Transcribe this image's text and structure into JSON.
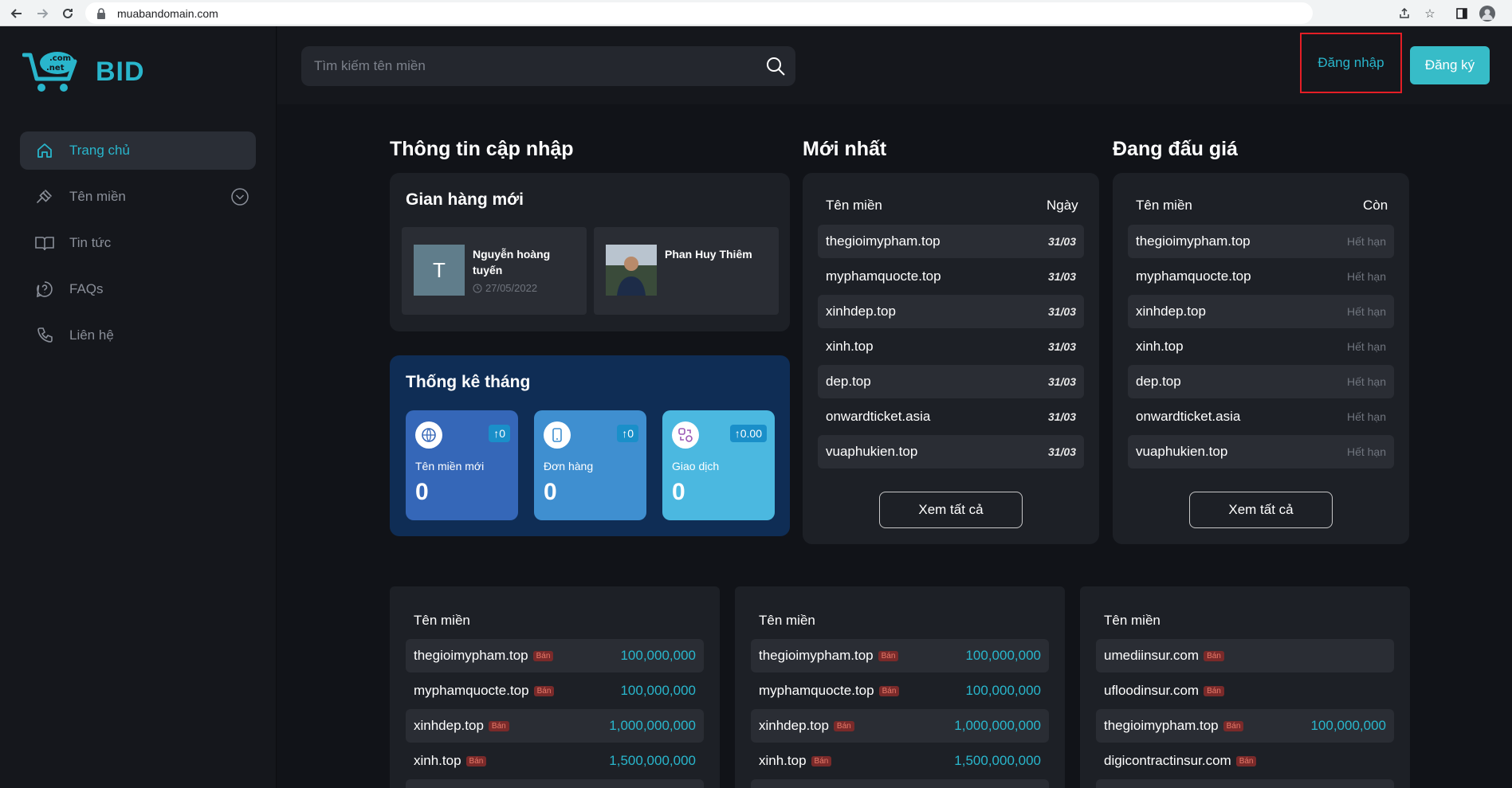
{
  "browser": {
    "url": "muabandomain.com"
  },
  "brand": {
    "logo_text": "BID",
    "logo_tag_top": ".com",
    "logo_tag_bottom": ".net"
  },
  "sidebar": {
    "items": [
      {
        "label": "Trang chủ",
        "icon": "home-icon",
        "active": true
      },
      {
        "label": "Tên miền",
        "icon": "gavel-icon",
        "has_chevron": true
      },
      {
        "label": "Tin tức",
        "icon": "book-icon"
      },
      {
        "label": "FAQs",
        "icon": "question-icon"
      },
      {
        "label": "Liên hệ",
        "icon": "phone-icon"
      }
    ]
  },
  "header": {
    "search_placeholder": "Tìm kiếm tên miền",
    "login_label": "Đăng nhập",
    "register_label": "Đăng ký"
  },
  "updates": {
    "title": "Thông tin cập nhập",
    "new_shops_title": "Gian hàng mới",
    "shops": [
      {
        "avatar_letter": "T",
        "name": "Nguyễn hoàng tuyến",
        "date": "27/05/2022"
      },
      {
        "name": "Phan Huy Thiêm"
      }
    ],
    "stats_title": "Thống kê tháng",
    "stats": [
      {
        "label": "Tên miền mới",
        "value": "0",
        "badge": "↑0",
        "color": "#3567b8"
      },
      {
        "label": "Đơn hàng",
        "value": "0",
        "badge": "↑0",
        "color": "#3f8fd0"
      },
      {
        "label": "Giao dịch",
        "value": "0",
        "badge": "↑0.00",
        "color": "#4bb8e0"
      }
    ]
  },
  "newest": {
    "title": "Mới nhất",
    "col_name": "Tên miền",
    "col_right": "Ngày",
    "rows": [
      {
        "name": "thegioimypham.top",
        "value": "31/03"
      },
      {
        "name": "myphamquocte.top",
        "value": "31/03"
      },
      {
        "name": "xinhdep.top",
        "value": "31/03"
      },
      {
        "name": "xinh.top",
        "value": "31/03"
      },
      {
        "name": "dep.top",
        "value": "31/03"
      },
      {
        "name": "onwardticket.asia",
        "value": "31/03"
      },
      {
        "name": "vuaphukien.top",
        "value": "31/03"
      }
    ],
    "view_all": "Xem tất cả"
  },
  "auction": {
    "title": "Đang đấu giá",
    "col_name": "Tên miền",
    "col_right": "Còn",
    "rows": [
      {
        "name": "thegioimypham.top",
        "value": "Hết hạn"
      },
      {
        "name": "myphamquocte.top",
        "value": "Hết hạn"
      },
      {
        "name": "xinhdep.top",
        "value": "Hết hạn"
      },
      {
        "name": "xinh.top",
        "value": "Hết hạn"
      },
      {
        "name": "dep.top",
        "value": "Hết hạn"
      },
      {
        "name": "onwardticket.asia",
        "value": "Hết hạn"
      },
      {
        "name": "vuaphukien.top",
        "value": "Hết hạn"
      }
    ],
    "view_all": "Xem tất cả"
  },
  "sale_badge": "Bán",
  "bottom_lists": [
    {
      "col_name": "Tên miền",
      "rows": [
        {
          "name": "thegioimypham.top",
          "price": "100,000,000"
        },
        {
          "name": "myphamquocte.top",
          "price": "100,000,000"
        },
        {
          "name": "xinhdep.top",
          "price": "1,000,000,000"
        },
        {
          "name": "xinh.top",
          "price": "1,500,000,000"
        }
      ]
    },
    {
      "col_name": "Tên miền",
      "rows": [
        {
          "name": "thegioimypham.top",
          "price": "100,000,000"
        },
        {
          "name": "myphamquocte.top",
          "price": "100,000,000"
        },
        {
          "name": "xinhdep.top",
          "price": "1,000,000,000"
        },
        {
          "name": "xinh.top",
          "price": "1,500,000,000"
        }
      ]
    },
    {
      "col_name": "Tên miền",
      "rows": [
        {
          "name": "umediinsur.com",
          "price": ""
        },
        {
          "name": "ufloodinsur.com",
          "price": ""
        },
        {
          "name": "thegioimypham.top",
          "price": "100,000,000"
        },
        {
          "name": "digicontractinsur.com",
          "price": ""
        }
      ]
    }
  ]
}
